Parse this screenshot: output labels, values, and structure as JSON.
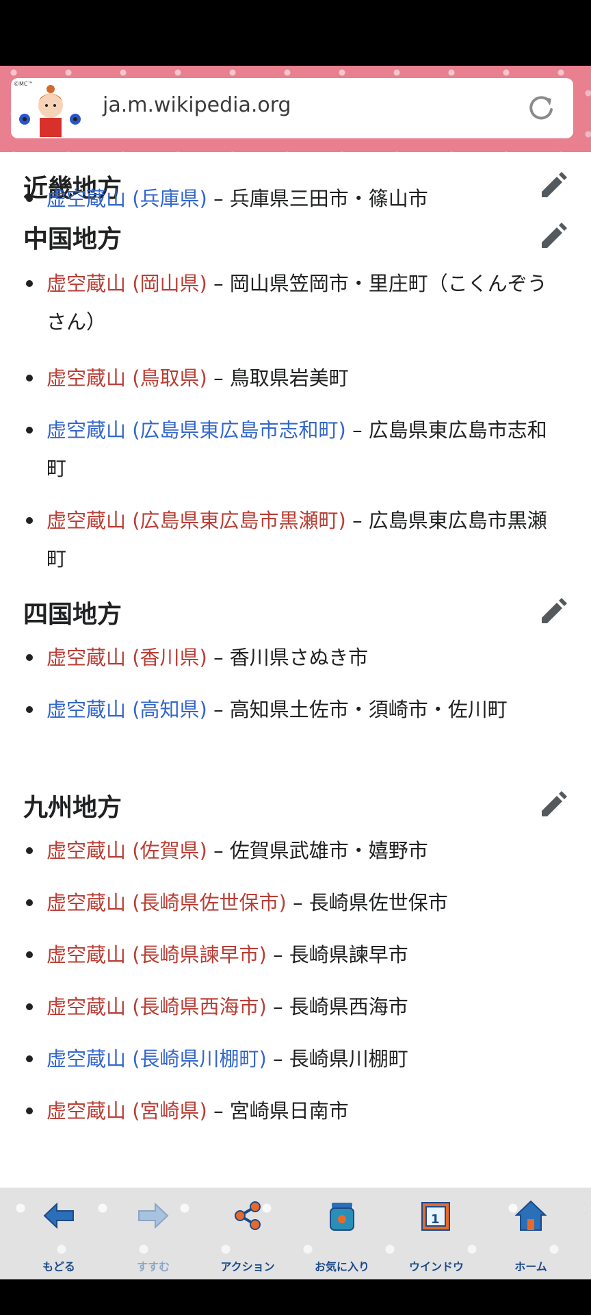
{
  "browser": {
    "url": "ja.m.wikipedia.org",
    "avatar_caption": "©MC™"
  },
  "sections": [
    {
      "heading": "近畿地方",
      "items": [
        {
          "link": "虚空蔵山 (兵庫県)",
          "rest": " – 兵庫県三田市・篠山市",
          "link_color": "blue"
        }
      ]
    },
    {
      "heading": "中国地方",
      "items": [
        {
          "link": "虚空蔵山 (岡山県)",
          "rest": " – 岡山県笠岡市・里庄町（こくんぞうさん）",
          "link_color": "red"
        },
        {
          "link": "虚空蔵山 (鳥取県)",
          "rest": " – 鳥取県岩美町",
          "link_color": "red"
        },
        {
          "link": "虚空蔵山 (広島県東広島市志和町)",
          "rest": " – 広島県東広島市志和町",
          "link_color": "blue"
        },
        {
          "link": "虚空蔵山 (広島県東広島市黒瀬町)",
          "rest": " – 広島県東広島市黒瀬町",
          "link_color": "red"
        }
      ]
    },
    {
      "heading": "四国地方",
      "items": [
        {
          "link": "虚空蔵山 (香川県)",
          "rest": " – 香川県さぬき市",
          "link_color": "red"
        },
        {
          "link": "虚空蔵山 (高知県)",
          "rest": " – 高知県土佐市・須崎市・佐川町",
          "link_color": "blue"
        }
      ]
    },
    {
      "heading": "九州地方",
      "items": [
        {
          "link": "虚空蔵山 (佐賀県)",
          "rest": " – 佐賀県武雄市・嬉野市",
          "link_color": "red"
        },
        {
          "link": "虚空蔵山 (長崎県佐世保市)",
          "rest": " – 長崎県佐世保市",
          "link_color": "red"
        },
        {
          "link": "虚空蔵山 (長崎県諫早市)",
          "rest": " – 長崎県諫早市",
          "link_color": "red"
        },
        {
          "link": "虚空蔵山 (長崎県西海市)",
          "rest": " – 長崎県西海市",
          "link_color": "red"
        },
        {
          "link": "虚空蔵山 (長崎県川棚町)",
          "rest": " – 長崎県川棚町",
          "link_color": "blue"
        },
        {
          "link": "虚空蔵山 (宮崎県)",
          "rest": " – 宮崎県日南市",
          "link_color": "red"
        }
      ]
    }
  ],
  "toolbar": {
    "back": "もどる",
    "forward": "すすむ",
    "action": "アクション",
    "favorites": "お気に入り",
    "window": "ウインドウ",
    "window_count": "1",
    "home": "ホーム"
  },
  "colors": {
    "link_red": "#ba3e35",
    "link_blue": "#3366cc",
    "urlbar_bg": "#e8808f",
    "toolbar_label": "#1a4a8a"
  }
}
